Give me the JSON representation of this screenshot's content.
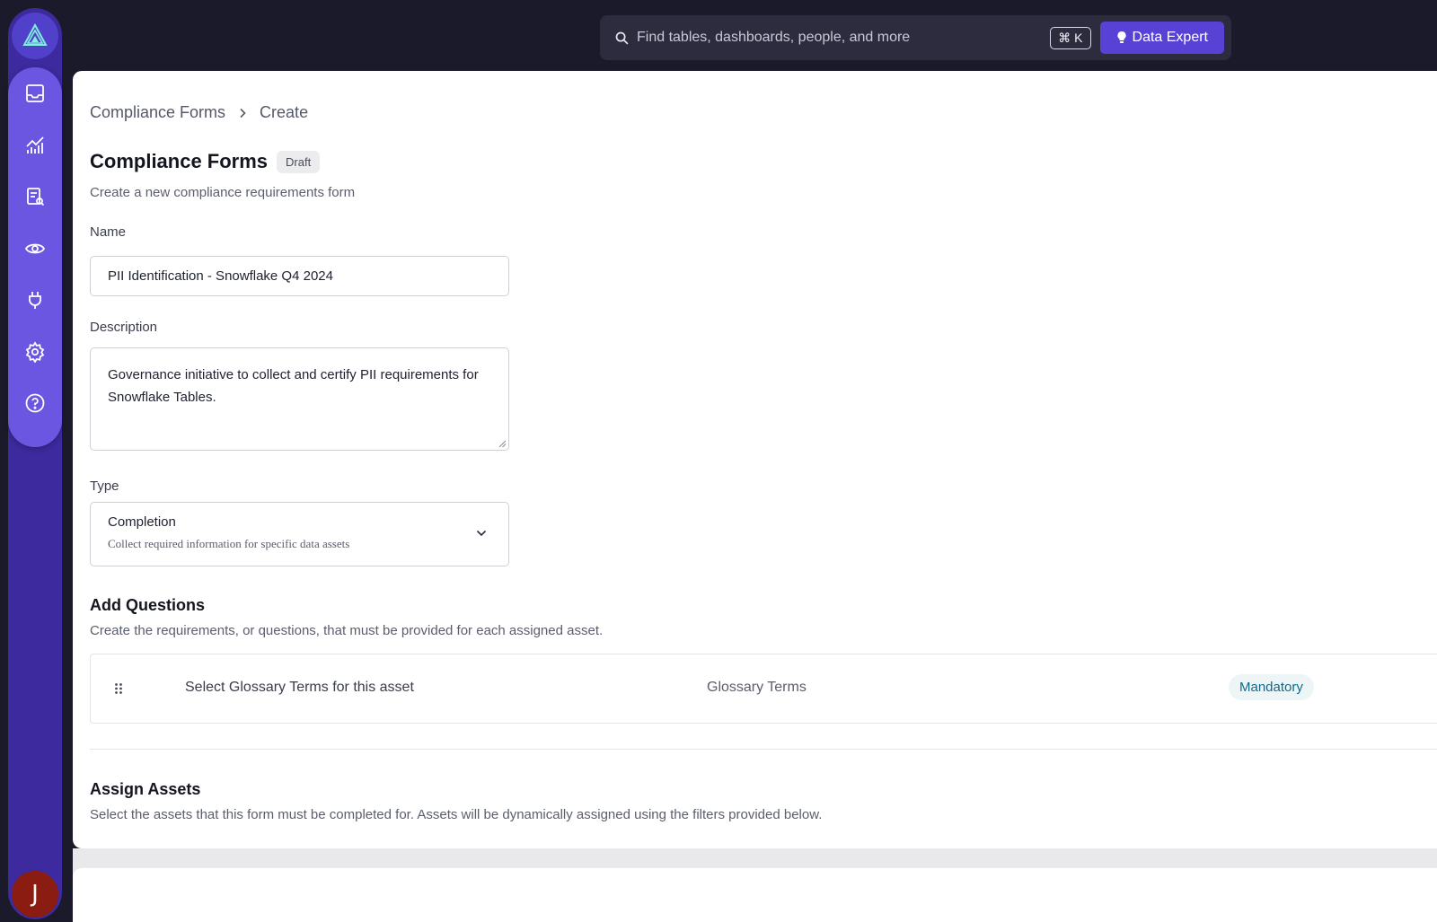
{
  "search": {
    "placeholder": "Find tables, dashboards, people, and more",
    "shortcut": "⌘ K",
    "expert_label": "Data Expert"
  },
  "sidebar": {
    "avatar_initial": "J",
    "items": [
      {
        "name": "inbox-icon"
      },
      {
        "name": "analytics-icon"
      },
      {
        "name": "documents-icon"
      },
      {
        "name": "eye-icon"
      },
      {
        "name": "plug-icon"
      },
      {
        "name": "gear-icon"
      },
      {
        "name": "help-icon"
      }
    ]
  },
  "breadcrumb": {
    "parent": "Compliance Forms",
    "current": "Create"
  },
  "page": {
    "title": "Compliance Forms",
    "status": "Draft",
    "subtitle": "Create a new compliance requirements form"
  },
  "form": {
    "name_label": "Name",
    "name_value": "PII Identification - Snowflake Q4 2024",
    "description_label": "Description",
    "description_value": "Governance initiative to collect and certify PII requirements for Snowflake Tables.",
    "type_label": "Type",
    "type_value": "Completion",
    "type_hint": "Collect required information for specific data assets"
  },
  "questions": {
    "title": "Add Questions",
    "description": "Create the requirements, or questions, that must be provided for each assigned asset.",
    "items": [
      {
        "text": "Select Glossary Terms for this asset",
        "type": "Glossary Terms",
        "requirement": "Mandatory"
      }
    ]
  },
  "assets": {
    "title": "Assign Assets",
    "description": "Select the assets that this form must be completed for. Assets will be dynamically assigned using the filters provided below."
  },
  "colors": {
    "accent": "#5842d6",
    "sidebar": "#3c2a9e",
    "topbar": "#1b1a2b"
  }
}
